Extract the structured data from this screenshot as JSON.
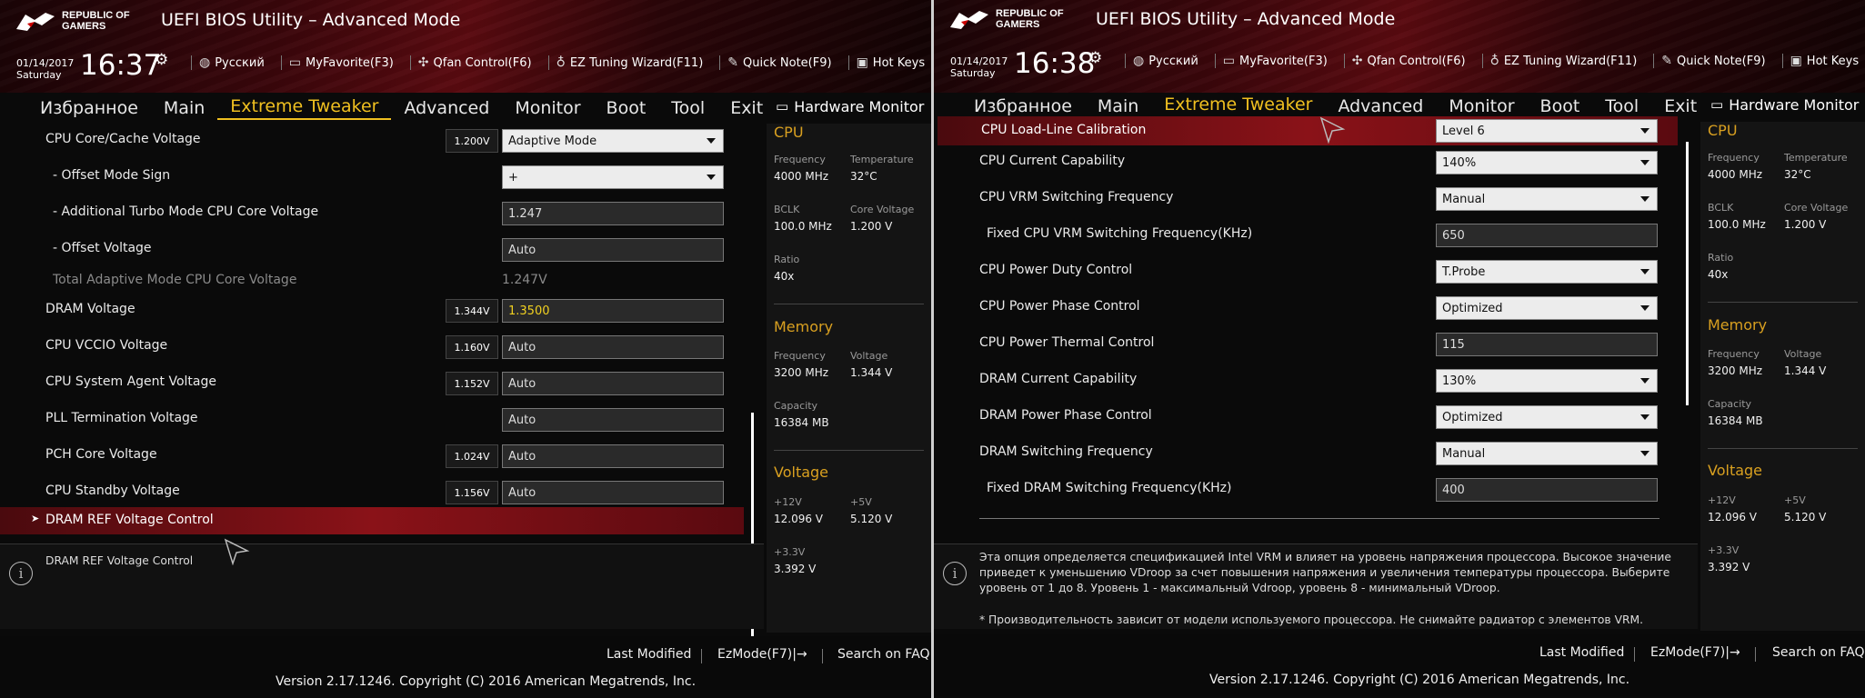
{
  "left": {
    "header": {
      "brand_line1": "REPUBLIC OF",
      "brand_line2": "GAMERS",
      "title": "UEFI BIOS Utility – Advanced Mode",
      "date": "01/14/2017",
      "day": "Saturday",
      "time": "16:37"
    },
    "toolbar": [
      "Русский",
      "MyFavorite(F3)",
      "Qfan Control(F6)",
      "EZ Tuning Wizard(F11)",
      "Quick Note(F9)",
      "Hot Keys"
    ],
    "menu": [
      "Избранное",
      "Main",
      "Extreme Tweaker",
      "Advanced",
      "Monitor",
      "Boot",
      "Tool",
      "Exit"
    ],
    "active_menu": "Extreme Tweaker",
    "hw_title": "Hardware Monitor",
    "settings": [
      {
        "label": "CPU Core/Cache Voltage",
        "current": "1.200V",
        "control": "dropdown",
        "value": "Adaptive Mode"
      },
      {
        "label": "- Offset Mode Sign",
        "current": "",
        "control": "dropdown",
        "value": "+"
      },
      {
        "label": "- Additional Turbo Mode CPU Core Voltage",
        "current": "",
        "control": "field",
        "value": "1.247"
      },
      {
        "label": "- Offset Voltage",
        "current": "",
        "control": "field",
        "value": "Auto"
      },
      {
        "label": "Total Adaptive Mode CPU Core Voltage",
        "current": "",
        "control": "text",
        "value": "1.247V"
      },
      {
        "label": "DRAM Voltage",
        "current": "1.344V",
        "control": "field-yellow",
        "value": "1.3500"
      },
      {
        "label": "CPU VCCIO Voltage",
        "current": "1.160V",
        "control": "field",
        "value": "Auto"
      },
      {
        "label": "CPU System Agent Voltage",
        "current": "1.152V",
        "control": "field",
        "value": "Auto"
      },
      {
        "label": "PLL Termination Voltage",
        "current": "",
        "control": "field",
        "value": "Auto"
      },
      {
        "label": "PCH Core Voltage",
        "current": "1.024V",
        "control": "field",
        "value": "Auto"
      },
      {
        "label": "CPU Standby Voltage",
        "current": "1.156V",
        "control": "field",
        "value": "Auto"
      },
      {
        "label": "DRAM REF Voltage Control",
        "current": "",
        "control": "submenu",
        "value": ""
      }
    ],
    "description": "DRAM REF Voltage Control",
    "footer": {
      "last_modified": "Last Modified",
      "ezmode": "EzMode(F7)|→",
      "faq": "Search on FAQ",
      "copyright": "Version 2.17.1246. Copyright (C) 2016 American Megatrends, Inc."
    }
  },
  "right": {
    "header": {
      "brand_line1": "REPUBLIC OF",
      "brand_line2": "GAMERS",
      "title": "UEFI BIOS Utility – Advanced Mode",
      "date": "01/14/2017",
      "day": "Saturday",
      "time": "16:38"
    },
    "toolbar": [
      "Русский",
      "MyFavorite(F3)",
      "Qfan Control(F6)",
      "EZ Tuning Wizard(F11)",
      "Quick Note(F9)",
      "Hot Keys"
    ],
    "menu": [
      "Избранное",
      "Main",
      "Extreme Tweaker",
      "Advanced",
      "Monitor",
      "Boot",
      "Tool",
      "Exit"
    ],
    "active_menu": "Extreme Tweaker",
    "hw_title": "Hardware Monitor",
    "settings": [
      {
        "label": "CPU Load-Line Calibration",
        "control": "dropdown",
        "value": "Level 6"
      },
      {
        "label": "CPU Current Capability",
        "control": "dropdown",
        "value": "140%"
      },
      {
        "label": "CPU VRM Switching Frequency",
        "control": "dropdown",
        "value": "Manual"
      },
      {
        "label": "Fixed CPU VRM Switching Frequency(KHz)",
        "control": "field",
        "value": "650"
      },
      {
        "label": "CPU Power Duty Control",
        "control": "dropdown",
        "value": "T.Probe"
      },
      {
        "label": "CPU Power Phase Control",
        "control": "dropdown",
        "value": "Optimized"
      },
      {
        "label": "CPU Power Thermal Control",
        "control": "field",
        "value": "115"
      },
      {
        "label": "DRAM Current Capability",
        "control": "dropdown",
        "value": "130%"
      },
      {
        "label": "DRAM Power Phase Control",
        "control": "dropdown",
        "value": "Optimized"
      },
      {
        "label": "DRAM Switching Frequency",
        "control": "dropdown",
        "value": "Manual"
      },
      {
        "label": "Fixed DRAM Switching Frequency(KHz)",
        "control": "field",
        "value": "400"
      }
    ],
    "description": "Эта опция определяется спецификацией Intel VRM и влияет на уровень напряжения процессора. Высокое значение приведет к уменьшению VDroop за счет повышения напряжения и увеличения температуры процессора. Выберите уровень от 1 до 8. Уровень 1 - максимальный Vdroop, уровень 8 - минимальный VDroop.",
    "description_note": "* Производительность зависит от модели используемого процессора. Не снимайте радиатор с элементов VRM.",
    "footer": {
      "last_modified": "Last Modified",
      "ezmode": "EzMode(F7)|→",
      "faq": "Search on FAQ",
      "copyright": "Version 2.17.1246. Copyright (C) 2016 American Megatrends, Inc."
    }
  },
  "hardware_monitor": {
    "cpu": {
      "title": "CPU",
      "frequency_label": "Frequency",
      "frequency": "4000 MHz",
      "temperature_label": "Temperature",
      "temperature": "32°C",
      "bclk_label": "BCLK",
      "bclk": "100.0 MHz",
      "core_voltage_label": "Core Voltage",
      "core_voltage": "1.200 V",
      "ratio_label": "Ratio",
      "ratio": "40x"
    },
    "memory": {
      "title": "Memory",
      "frequency_label": "Frequency",
      "frequency": "3200 MHz",
      "voltage_label": "Voltage",
      "voltage": "1.344 V",
      "capacity_label": "Capacity",
      "capacity": "16384 MB"
    },
    "voltage": {
      "title": "Voltage",
      "v12_label": "+12V",
      "v12": "12.096 V",
      "v5_label": "+5V",
      "v5": "5.120 V",
      "v33_label": "+3.3V",
      "v33": "3.392 V"
    }
  },
  "colors": {
    "accent_yellow": "#f0c020",
    "section_orange": "#d9a020",
    "selection_red": "#8a1218",
    "background": "#0a0a0a"
  },
  "icons": {
    "gear": "gear-icon",
    "globe": "globe-icon",
    "favorite": "star-icon",
    "fan": "fan-icon",
    "wizard": "bulb-icon",
    "note": "note-icon",
    "hotkeys": "help-icon",
    "monitor": "monitor-icon",
    "info": "info-icon"
  }
}
